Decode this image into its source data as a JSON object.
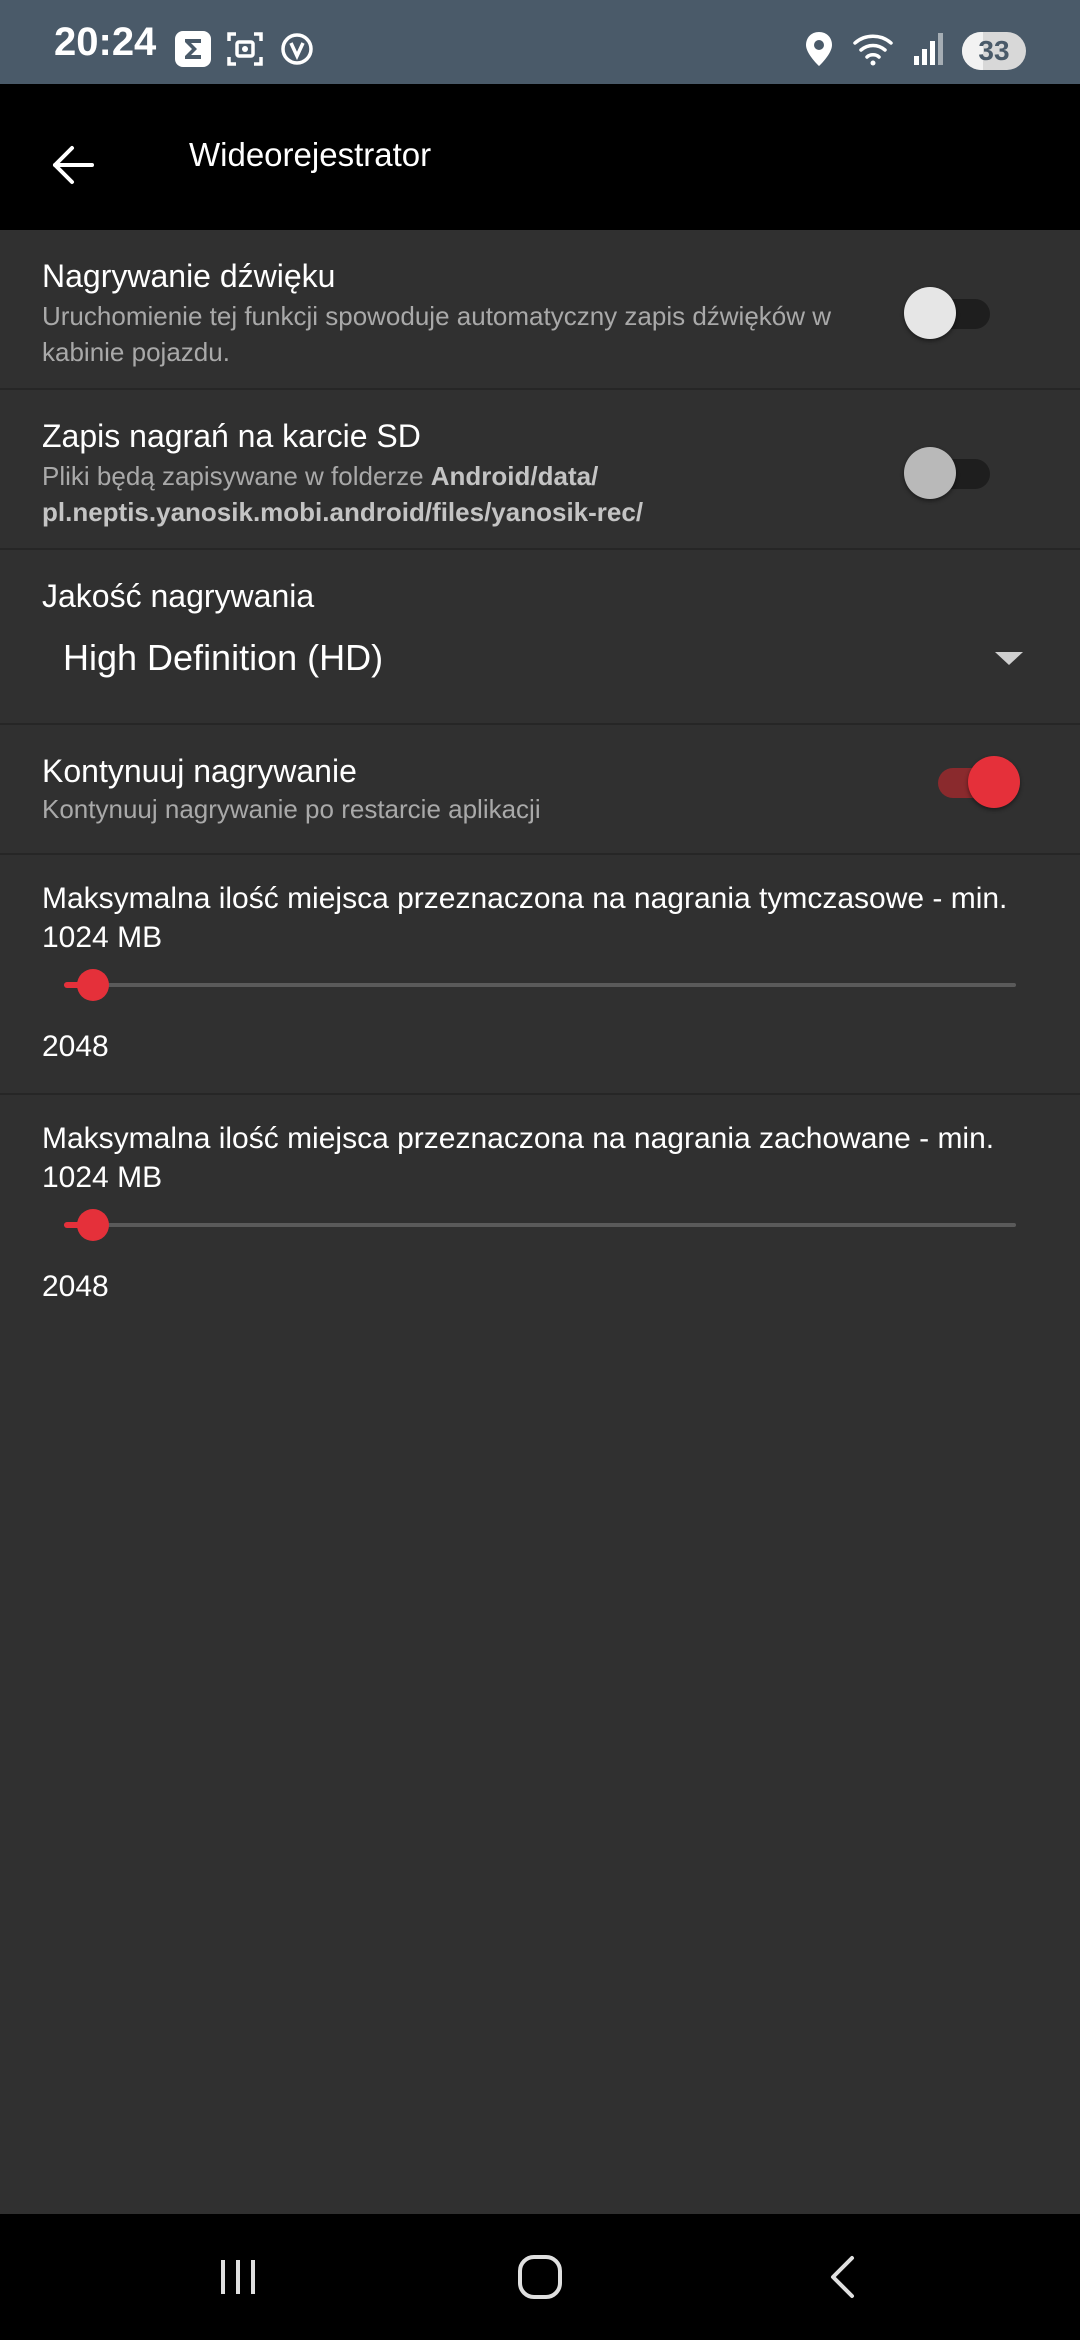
{
  "status_bar": {
    "time": "20:24",
    "battery_level": "33",
    "left_icons": [
      "sigma-notification-icon",
      "screenshot-icon",
      "vpn-shield-icon"
    ],
    "right_icons": [
      "location-icon",
      "wifi-icon",
      "signal-icon",
      "battery-icon"
    ]
  },
  "app_bar": {
    "title": "Wideorejestrator",
    "back_icon": "arrow-left-icon"
  },
  "settings": {
    "sound_recording": {
      "title": "Nagrywanie dźwięku",
      "summary": "Uruchomienie tej funkcji spowoduje automatyczny zapis dźwięków w kabinie pojazdu.",
      "enabled": false
    },
    "sd_card": {
      "title": "Zapis nagrań na karcie SD",
      "summary_prefix": "Pliki będą zapisywane w folderze ",
      "summary_path": "Android/data/ pl.neptis.yanosik.mobi.android/files/yanosik-rec/",
      "enabled": false
    },
    "quality": {
      "title": "Jakość nagrywania",
      "value": "High Definition (HD)"
    },
    "continue_recording": {
      "title": "Kontynuuj nagrywanie",
      "summary": "Kontynuuj nagrywanie po restarcie aplikacji",
      "enabled": true
    },
    "temp_space": {
      "title": "Maksymalna ilość miejsca przeznaczona na nagrania tymczasowe - min. 1024 MB",
      "value": "2048",
      "fraction": 0.03
    },
    "saved_space": {
      "title": "Maksymalna ilość miejsca przeznaczona na nagrania zachowane - min. 1024 MB",
      "value": "2048",
      "fraction": 0.03
    }
  },
  "nav_bar": {
    "recents_icon": "recents-icon",
    "home_icon": "home-icon",
    "back_icon": "back-chevron-icon"
  },
  "colors": {
    "accent": "#e5303a",
    "background": "#303030",
    "app_bar": "#000000",
    "status_bar": "#4a5a69"
  }
}
